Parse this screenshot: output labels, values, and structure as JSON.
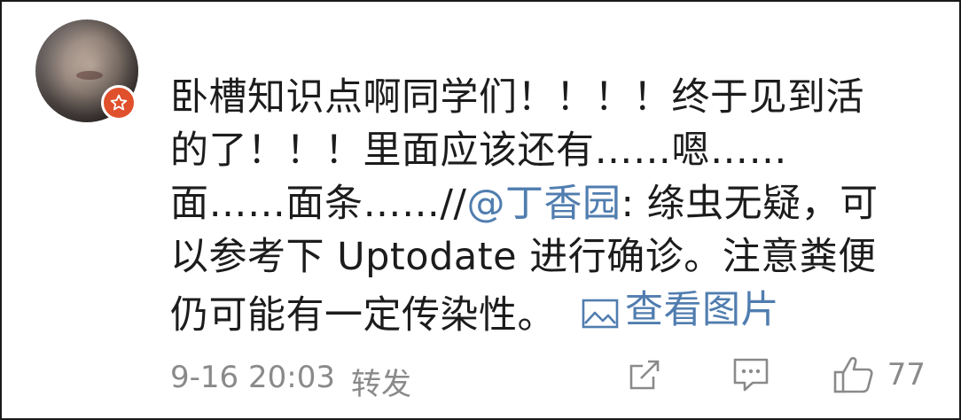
{
  "comment": {
    "text": "卧槽知识点啊同学们！！！！终于见到活的了！！！里面应该还有……嗯……面……面条……//",
    "mention": "@丁香园",
    "quoted_text": ": 绦虫无疑，可以参考下 Uptodate 进行确诊。注意粪便仍可能有一定传染性。",
    "view_image_label": "查看图片"
  },
  "meta": {
    "timestamp": "9-16 20:03",
    "repost_label": "转发"
  },
  "actions": {
    "like_count": "77"
  },
  "colors": {
    "text": "#1c1c1c",
    "link": "#507daf",
    "meta": "#8a8a8a",
    "badge": "#e0502c"
  },
  "icons": {
    "avatar_badge": "verified-star-icon",
    "view_image": "image-icon",
    "share": "share-icon",
    "comment": "comment-icon",
    "like": "thumbs-up-icon"
  }
}
